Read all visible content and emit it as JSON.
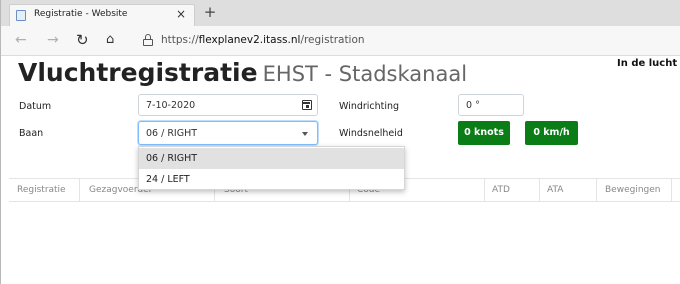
{
  "browser": {
    "tab_title": "Registratie - Website",
    "tab_close": "×",
    "new_tab": "+",
    "back": "←",
    "forward": "→",
    "reload": "↻",
    "home": "⌂",
    "url_prefix": "https://",
    "url_host": "flexplanev2.itass.nl",
    "url_path": "/registration"
  },
  "page": {
    "title": "Vluchtregistratie",
    "subtitle": "EHST - Stadskanaal",
    "status": "In de lucht"
  },
  "form": {
    "datum_label": "Datum",
    "datum_value": "7-10-2020",
    "baan_label": "Baan",
    "baan_value": "06 / RIGHT",
    "windrichting_label": "Windrichting",
    "windrichting_value": "0 °",
    "windsnelheid_label": "Windsnelheid",
    "windsnelheid_knots": "0 knots",
    "windsnelheid_kmh": "0 km/h"
  },
  "dropdown": {
    "options": [
      "06 / RIGHT",
      "24 / LEFT"
    ],
    "selected": "06 / RIGHT"
  },
  "table": {
    "columns": [
      "Registratie",
      "Gezagvoerder",
      "Soort",
      "Code",
      "ATD",
      "ATA",
      "Bewegingen"
    ]
  },
  "colors": {
    "badge_green": "#0b7d16",
    "focus_blue": "#80bdff"
  },
  "icons": {
    "calendar": "calendar-icon",
    "caret": "chevron-down-icon",
    "lock": "lock-icon"
  }
}
